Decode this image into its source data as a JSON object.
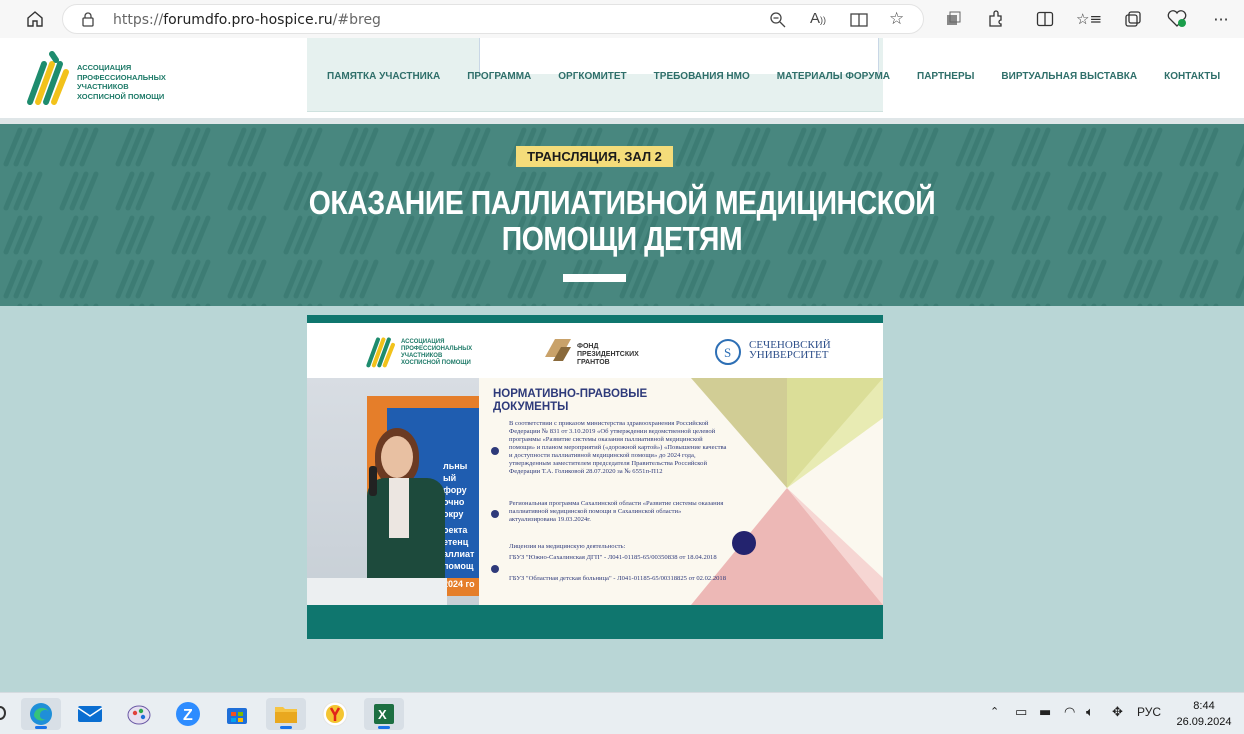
{
  "browser": {
    "url_scheme": "https://",
    "url_host": "forumdfo.pro-hospice.ru",
    "url_path": "/#breg",
    "icons": {
      "home": "home-icon",
      "lock": "lock-icon",
      "zoom": "zoom-out-icon",
      "read_aloud": "read-aloud-icon",
      "immersive": "immersive-reader-icon",
      "favorite": "star-icon",
      "extensions": "puzzle-icon",
      "split": "split-screen-icon",
      "favorites_bar": "favorites-list-icon",
      "collections": "collections-icon",
      "browser_essentials": "heart-pulse-icon",
      "menu": "more-menu-icon"
    }
  },
  "site": {
    "logo_lines": [
      "АССОЦИАЦИЯ",
      "ПРОФЕССИОНАЛЬНЫХ",
      "УЧАСТНИКОВ",
      "ХОСПИСНОЙ ПОМОЩИ"
    ],
    "nav": [
      "ПАМЯТКА УЧАСТНИКА",
      "ПРОГРАММА",
      "ОРГКОМИТЕТ",
      "ТРЕБОВАНИЯ НМО",
      "МАТЕРИАЛЫ ФОРУМА",
      "ПАРТНЕРЫ",
      "ВИРТУАЛЬНАЯ ВЫСТАВКА",
      "КОНТАКТЫ"
    ],
    "colors": {
      "brand_green": "#1e7a68",
      "hero_bg": "#48877f",
      "page_bg": "#b9d6d6",
      "badge": "#f4dc7a"
    }
  },
  "hero": {
    "badge": "ТРАНСЛЯЦИЯ, ЗАЛ 2",
    "title_line1": "ОКАЗАНИЕ ПАЛЛИАТИВНОЙ МЕДИЦИНСКОЙ",
    "title_line2": "ПОМОЩИ ДЕТЯМ"
  },
  "video": {
    "partners": {
      "association": [
        "АССОЦИАЦИЯ",
        "ПРОФЕССИОНАЛЬНЫХ",
        "УЧАСТНИКОВ",
        "ХОСПИСНОЙ ПОМОЩИ"
      ],
      "fund": [
        "ФОНД",
        "ПРЕЗИДЕНТСКИХ",
        "ГРАНТОВ"
      ],
      "university": [
        "СЕЧЕНОВСКИЙ",
        "УНИВЕРСИТЕТ"
      ]
    },
    "slide_title_line1": "НОРМАТИВНО-ПРАВОВЫЕ",
    "slide_title_line2": "ДОКУМЕНТЫ",
    "para1": "В соответствии с приказом министерства здравоохранения Российской Федерации № 831 от 3.10.2019 «Об утверждении ведомственной целевой программы «Развитие системы оказания паллиативной медицинской помощи» и планом мероприятий («дорожной картой») «Повышение качества и доступности паллиативной медицинской помощи» до 2024 года, утвержденным заместителем председателя Правительства Российской Федерации Т.А. Голиковой 28.07.2020 за № 6551п-П12",
    "para2": "Региональная программа Сахалинской области «Развитие системы оказания паллиативной медицинской помощи в Сахалинской области» актуализирована 19.03.2024г.",
    "para3_head": "Лицензия на медицинскую деятельность:",
    "para3_a": "ГБУЗ \"Южно-Сахалинская ДГП\" - Л041-01185-65/00350838 от 18.04.2018",
    "para3_b": "ГБУЗ \"Областная детская больница\" - Л041-01185-65/00318825 от 02.02.2018",
    "banner_text": [
      "льны",
      "ый",
      "фору",
      "очно",
      "окру",
      "оекта",
      "етенц",
      "аллиат",
      "помощ",
      "2024 го"
    ]
  },
  "taskbar": {
    "apps": [
      "start-icon",
      "edge-icon",
      "mail-icon",
      "paint-icon",
      "zoom-icon",
      "store-icon",
      "explorer-icon",
      "yandex-icon",
      "excel-icon"
    ],
    "tray_lang": "РУС",
    "time": "8:44",
    "date": "26.09.2024"
  }
}
